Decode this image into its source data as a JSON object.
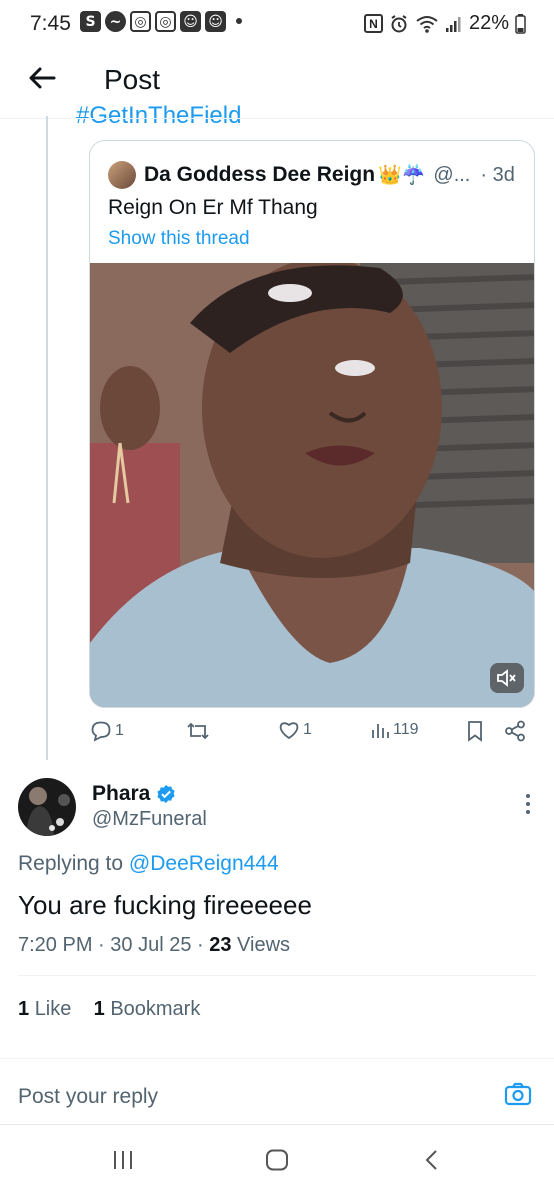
{
  "status_bar": {
    "time": "7:45",
    "battery": "22%",
    "app_icons": [
      "S",
      "messenger",
      "instagram",
      "instagram",
      "app",
      "app"
    ],
    "nfc": "N"
  },
  "header": {
    "title": "Post"
  },
  "thread": {
    "hashtag_partial": "#GetInTheField"
  },
  "quoted_post": {
    "author_name": "Da Goddess Dee Reign",
    "author_emoji": "👑☔",
    "handle": "@...",
    "time": "· 3d",
    "text": "Reign On Er Mf Thang",
    "show_thread": "Show this thread"
  },
  "actions": {
    "replies": "1",
    "reposts": "",
    "likes": "1",
    "views": "119"
  },
  "reply": {
    "name": "Phara",
    "handle": "@MzFuneral",
    "replying_prefix": "Replying to ",
    "replying_to": "@DeeReign444",
    "text": "You are fucking fireeeeee",
    "time": "7:20 PM",
    "date": "30 Jul 25",
    "views_count": "23",
    "views_label": "Views",
    "likes_count": "1",
    "likes_label": "Like",
    "bookmarks_count": "1",
    "bookmarks_label": "Bookmark"
  },
  "reply_box": {
    "placeholder": "Post your reply"
  },
  "colors": {
    "accent": "#1d9bf0",
    "muted": "#536471",
    "text": "#0f1419"
  }
}
